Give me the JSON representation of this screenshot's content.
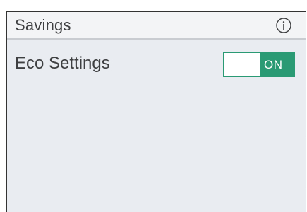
{
  "header": {
    "title": "Savings",
    "info_icon": "info-icon"
  },
  "rows": [
    {
      "label": "Eco Settings",
      "toggle": {
        "state_text": "ON",
        "on": true,
        "color": "#2a9a74"
      }
    },
    {
      "label": ""
    },
    {
      "label": ""
    }
  ]
}
